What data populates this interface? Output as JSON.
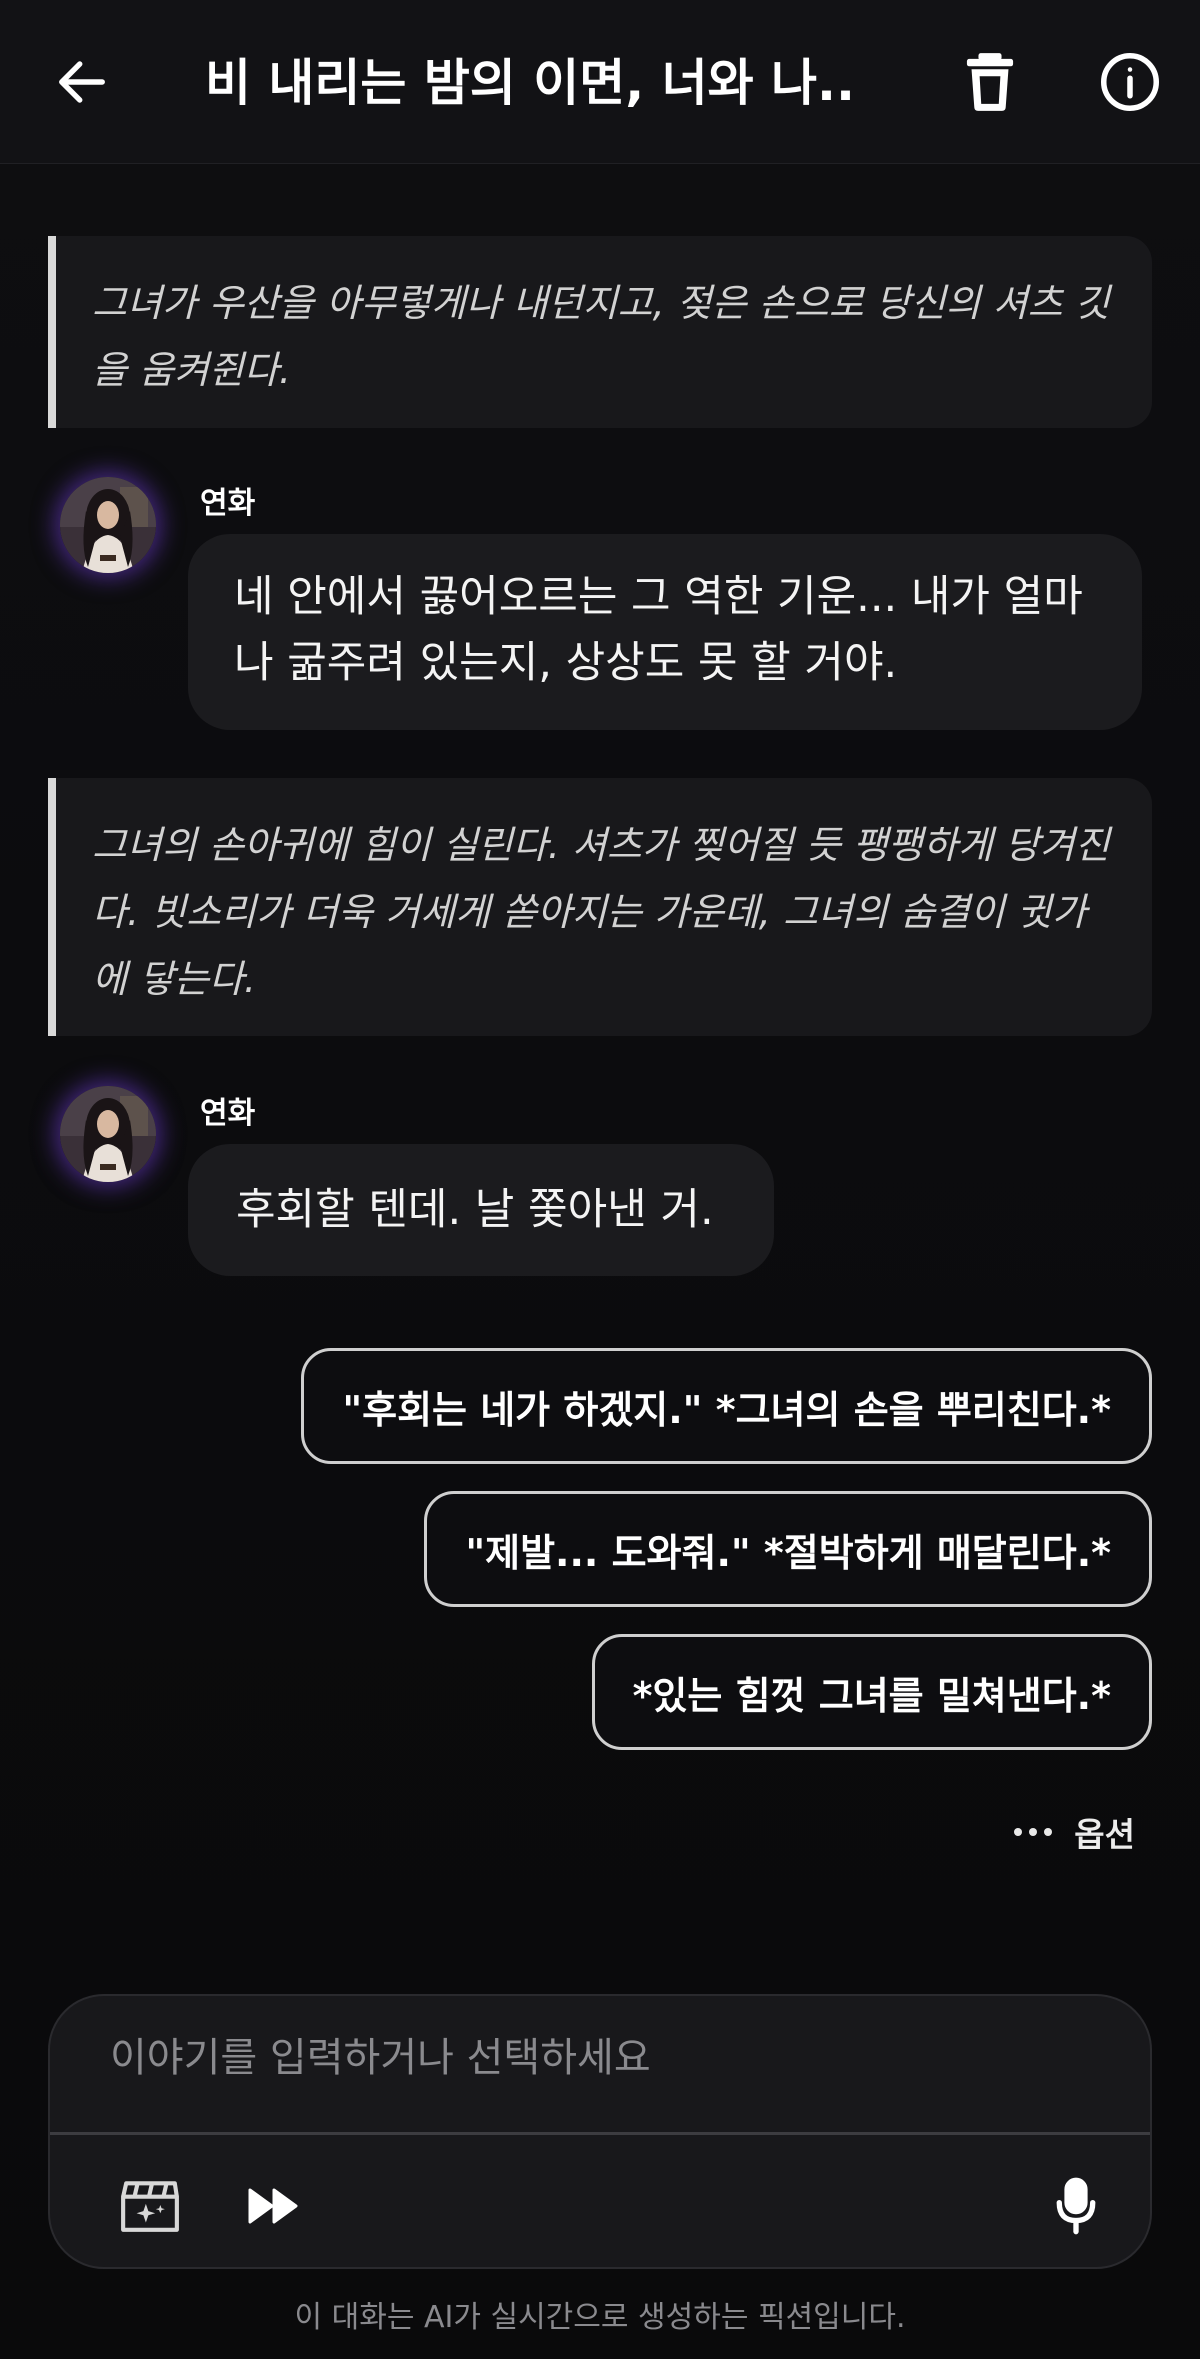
{
  "header": {
    "title": "비 내리는 밤의 이면, 너와 나...",
    "back_icon": "arrow-left-icon",
    "delete_icon": "trash-icon",
    "info_icon": "info-icon"
  },
  "messages": [
    {
      "type": "narration",
      "text": "그녀가 우산을 아무렇게나 내던지고, 젖은 손으로 당신의 셔츠 깃을 움켜쥔다."
    },
    {
      "type": "character",
      "speaker": "연화",
      "avatar_icon": "character-avatar",
      "text": "네 안에서 끓어오르는 그 역한 기운... 내가 얼마나 굶주려 있는지, 상상도 못 할 거야."
    },
    {
      "type": "narration",
      "text": "그녀의 손아귀에 힘이 실린다. 셔츠가 찢어질 듯 팽팽하게 당겨진다. 빗소리가 더욱 거세게 쏟아지는 가운데, 그녀의 숨결이 귓가에 닿는다."
    },
    {
      "type": "character",
      "speaker": "연화",
      "avatar_icon": "character-avatar",
      "text": "후회할 텐데. 날 쫓아낸 거."
    }
  ],
  "choices": [
    "\"후회는 네가 하겠지.\" *그녀의 손을 뿌리친다.*",
    "\"제발... 도와줘.\" *절박하게 매달린다.*",
    "*있는 힘껏 그녀를 밀쳐낸다.*"
  ],
  "options": {
    "label": "옵션",
    "icon": "more-dots-icon"
  },
  "input": {
    "placeholder": "이야기를 입력하거나 선택하세요",
    "value": "",
    "scene_icon": "clapperboard-sparkle-icon",
    "skip_icon": "fast-forward-icon",
    "mic_icon": "microphone-icon"
  },
  "footer": {
    "disclaimer": "이 대화는 AI가 실시간으로 생성하는 픽션입니다."
  },
  "colors": {
    "background": "#0a0a0c",
    "header_bg": "#121215",
    "bubble_bg": "#1b1b1e",
    "narration_bar": "#d9d9d9",
    "avatar_glow": "#6e3cd2"
  }
}
